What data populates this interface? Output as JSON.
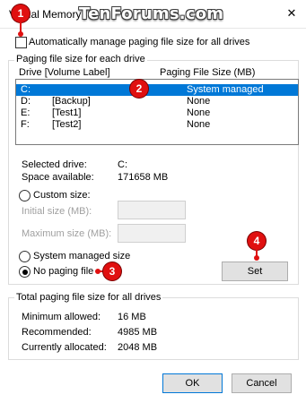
{
  "window": {
    "title": "Virtual Memory",
    "close_glyph": "✕",
    "watermark": "TenForums.com"
  },
  "auto_manage": {
    "label": "Automatically manage paging file size for all drives",
    "checked": false
  },
  "paging_group": {
    "title": "Paging file size for each drive",
    "col_drive": "Drive  [Volume Label]",
    "col_size": "Paging File Size (MB)",
    "rows": [
      {
        "drive": "C:",
        "label": "",
        "size": "System managed",
        "selected": true
      },
      {
        "drive": "D:",
        "label": "[Backup]",
        "size": "None",
        "selected": false
      },
      {
        "drive": "E:",
        "label": "[Test1]",
        "size": "None",
        "selected": false
      },
      {
        "drive": "F:",
        "label": "[Test2]",
        "size": "None",
        "selected": false
      }
    ],
    "selected_drive_label": "Selected drive:",
    "selected_drive_value": "C:",
    "space_label": "Space available:",
    "space_value": "171658 MB",
    "custom_size_label": "Custom size:",
    "initial_size_label": "Initial size (MB):",
    "maximum_size_label": "Maximum size (MB):",
    "initial_size_value": "",
    "maximum_size_value": "",
    "system_managed_label": "System managed size",
    "no_paging_label": "No paging file",
    "selected_option": "No paging file",
    "set_button": "Set"
  },
  "total_group": {
    "title": "Total paging file size for all drives",
    "min_label": "Minimum allowed:",
    "min_value": "16 MB",
    "rec_label": "Recommended:",
    "rec_value": "4985 MB",
    "cur_label": "Currently allocated:",
    "cur_value": "2048 MB"
  },
  "buttons": {
    "ok": "OK",
    "cancel": "Cancel"
  },
  "callouts": {
    "c1": "1",
    "c2": "2",
    "c3": "3",
    "c4": "4"
  },
  "colors": {
    "selection": "#0078d7",
    "callout": "#e01010"
  }
}
